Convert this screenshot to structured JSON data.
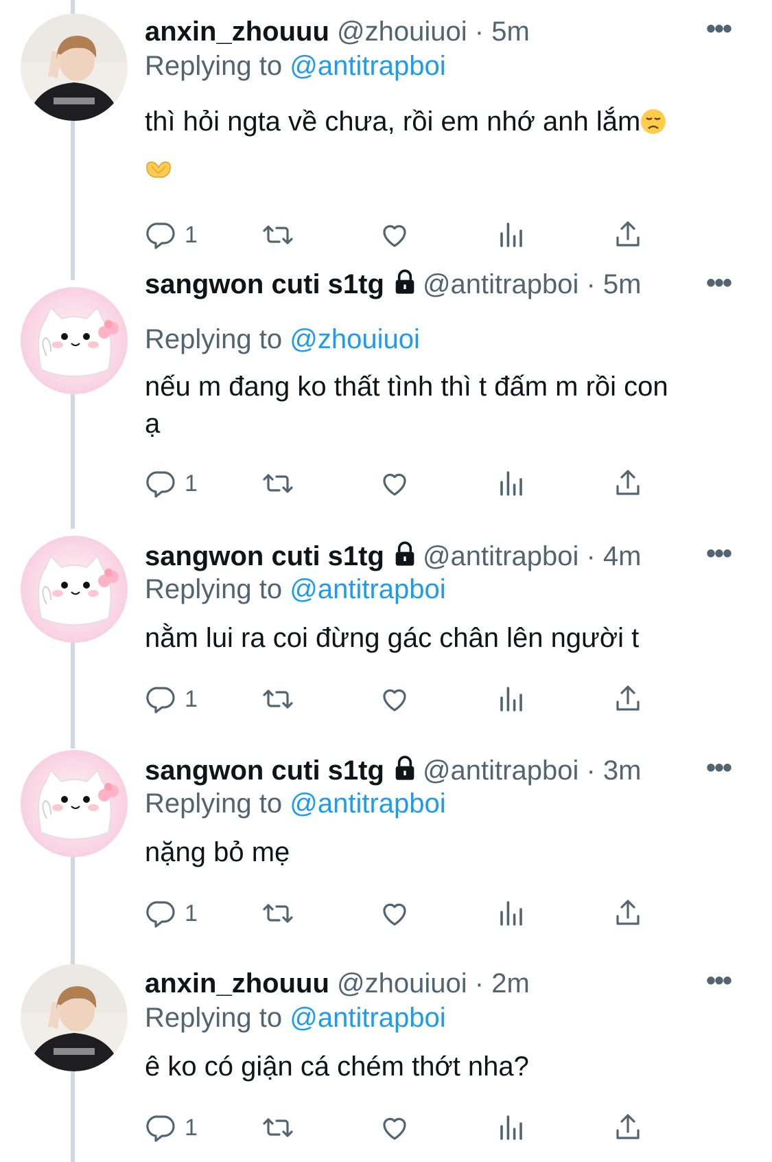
{
  "colors": {
    "text": "#0f1419",
    "secondary": "#536471",
    "link": "#1d9bf0",
    "thread_line": "#cfd9de"
  },
  "tweets": [
    {
      "name": "anxin_zhouuu",
      "handle": "@zhouiuoi",
      "separator": "·",
      "time": "5m",
      "locked": false,
      "replying_label": "Replying to",
      "replying_to": "@antitrapboi",
      "text": "thì hỏi ngta về chưa, rồi em nhớ anh lắm",
      "emoji_inline": "disappointed-face",
      "emoji_next_line": "heart-hands",
      "reply_count": "1",
      "avatar": "person-photo"
    },
    {
      "name": "sangwon cuti s1tg",
      "handle": "@antitrapboi",
      "separator": "·",
      "time": "5m",
      "locked": true,
      "replying_label": "Replying to",
      "replying_to": "@zhouiuoi",
      "text": "nếu m đang ko thất tình thì t đấm m rồi con ạ",
      "reply_count": "1",
      "avatar": "cat-sticker"
    },
    {
      "name": "sangwon cuti s1tg",
      "handle": "@antitrapboi",
      "separator": "·",
      "time": "4m",
      "locked": true,
      "replying_label": "Replying to",
      "replying_to": "@antitrapboi",
      "text": "nằm lui ra coi đừng gác chân lên người t",
      "reply_count": "1",
      "avatar": "cat-sticker"
    },
    {
      "name": "sangwon cuti s1tg",
      "handle": "@antitrapboi",
      "separator": "·",
      "time": "3m",
      "locked": true,
      "replying_label": "Replying to",
      "replying_to": "@antitrapboi",
      "text": "nặng bỏ mẹ",
      "reply_count": "1",
      "avatar": "cat-sticker"
    },
    {
      "name": "anxin_zhouuu",
      "handle": "@zhouiuoi",
      "separator": "·",
      "time": "2m",
      "locked": false,
      "replying_label": "Replying to",
      "replying_to": "@antitrapboi",
      "text": "ê ko có giận cá chém thớt nha?",
      "reply_count": "1",
      "avatar": "person-photo"
    }
  ],
  "more_label": "•••"
}
